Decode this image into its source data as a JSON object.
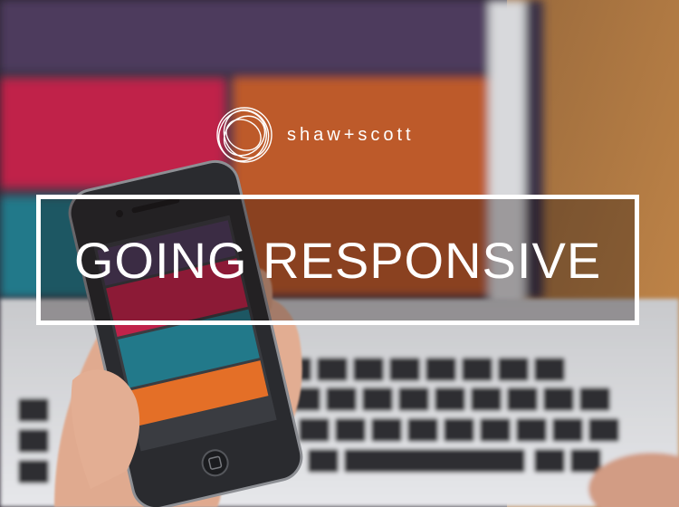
{
  "logo": {
    "brand": "shaw+scott",
    "icon": "concentric-rings-icon"
  },
  "headline": {
    "text": "GOING RESPONSIVE"
  },
  "colors": {
    "purple": "#4d3b5d",
    "magenta": "#c0224a",
    "orange": "#bd5a29",
    "teal": "#22798a",
    "phone_orange": "#e46f27",
    "wood": "#b0773d"
  }
}
